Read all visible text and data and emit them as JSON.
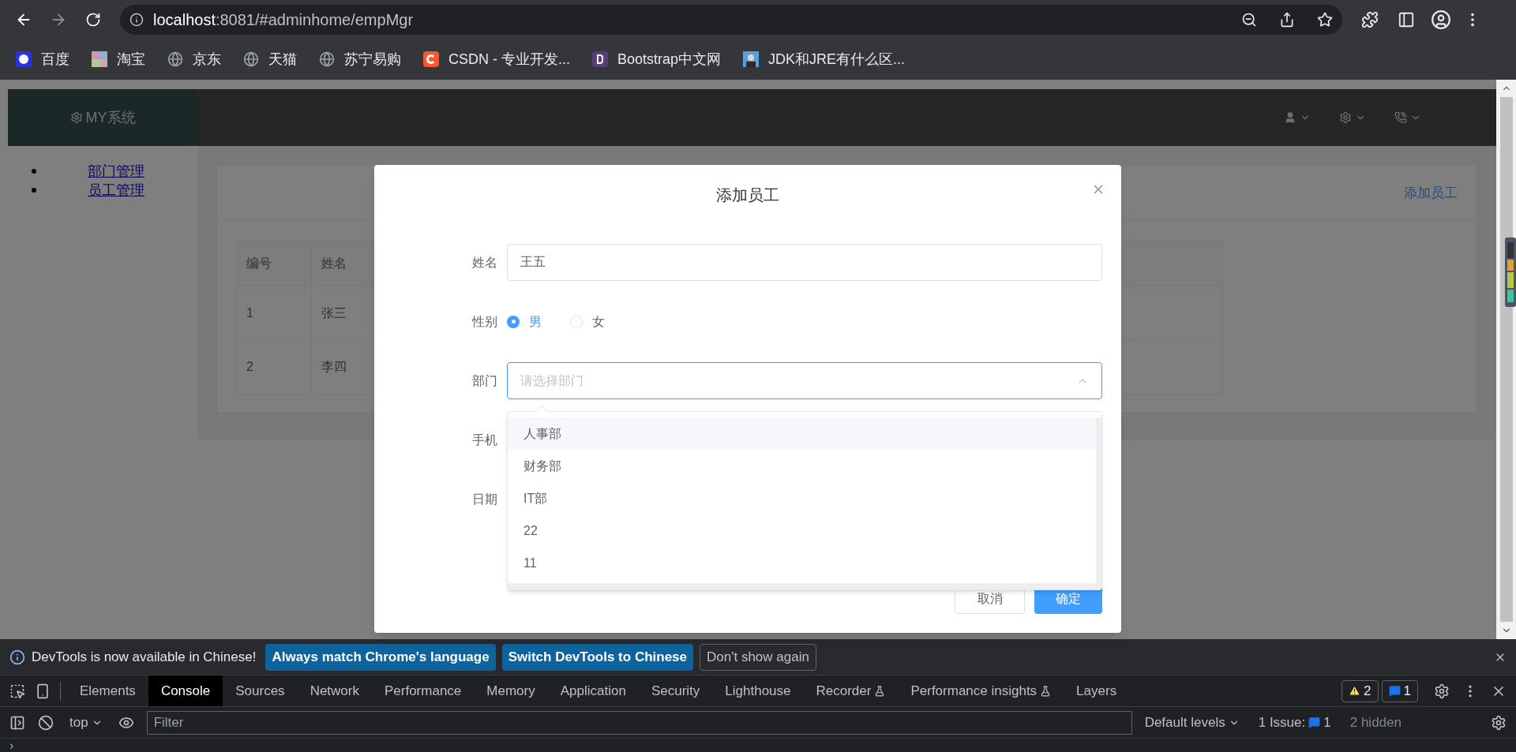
{
  "browser": {
    "back_enabled": true,
    "forward_enabled": false,
    "url_host": "localhost",
    "url_rest": ":8081/#adminhome/empMgr",
    "bookmarks": [
      {
        "label": "百度",
        "kind": "baidu"
      },
      {
        "label": "淘宝",
        "kind": "mosaic"
      },
      {
        "label": "京东",
        "kind": "globe"
      },
      {
        "label": "天猫",
        "kind": "globe"
      },
      {
        "label": "苏宁易购",
        "kind": "globe"
      },
      {
        "label": "CSDN - 专业开发...",
        "kind": "csdn"
      },
      {
        "label": "Bootstrap中文网",
        "kind": "bootstrap"
      },
      {
        "label": "JDK和JRE有什么区...",
        "kind": "avatar"
      }
    ]
  },
  "app": {
    "logo": "MY系统",
    "sidebar": [
      {
        "label": "部门管理"
      },
      {
        "label": "员工管理"
      }
    ],
    "add_link": "添加员工",
    "table": {
      "columns": [
        "编号",
        "姓名"
      ],
      "rows": [
        [
          "1",
          "张三"
        ],
        [
          "2",
          "李四"
        ]
      ]
    }
  },
  "dialog": {
    "title": "添加员工",
    "fields": [
      {
        "label": "姓名",
        "kind": "text",
        "value": "王五"
      },
      {
        "label": "性别",
        "kind": "radio",
        "options": [
          {
            "label": "男",
            "selected": true
          },
          {
            "label": "女",
            "selected": false
          }
        ]
      },
      {
        "label": "部门",
        "kind": "select",
        "placeholder": "请选择部门",
        "expanded": true
      },
      {
        "label": "手机",
        "kind": "covered"
      },
      {
        "label": "日期",
        "kind": "covered"
      }
    ],
    "dropdown": [
      {
        "label": "人事部",
        "highlighted": true
      },
      {
        "label": "财务部",
        "highlighted": false
      },
      {
        "label": "IT部",
        "highlighted": false
      },
      {
        "label": "22",
        "highlighted": false
      },
      {
        "label": "11",
        "highlighted": false
      }
    ],
    "buttons": [
      {
        "label": "取消",
        "kind": "default"
      },
      {
        "label": "确定",
        "kind": "primary"
      }
    ]
  },
  "devtools": {
    "notice": "DevTools is now available in Chinese!",
    "notice_buttons": [
      {
        "label": "Always match Chrome's language",
        "kind": "primary"
      },
      {
        "label": "Switch DevTools to Chinese",
        "kind": "primary"
      },
      {
        "label": "Don't show again",
        "kind": "plain"
      }
    ],
    "tabs": [
      {
        "label": "Elements",
        "selected": false,
        "experimental": false
      },
      {
        "label": "Console",
        "selected": true,
        "experimental": false
      },
      {
        "label": "Sources",
        "selected": false,
        "experimental": false
      },
      {
        "label": "Network",
        "selected": false,
        "experimental": false
      },
      {
        "label": "Performance",
        "selected": false,
        "experimental": false
      },
      {
        "label": "Memory",
        "selected": false,
        "experimental": false
      },
      {
        "label": "Application",
        "selected": false,
        "experimental": false
      },
      {
        "label": "Security",
        "selected": false,
        "experimental": false
      },
      {
        "label": "Lighthouse",
        "selected": false,
        "experimental": false
      },
      {
        "label": "Recorder",
        "selected": false,
        "experimental": true
      },
      {
        "label": "Performance insights",
        "selected": false,
        "experimental": true
      },
      {
        "label": "Layers",
        "selected": false,
        "experimental": false
      }
    ],
    "warnings": "2",
    "messages": "1",
    "context": "top",
    "filter_placeholder": "Filter",
    "levels": "Default levels",
    "issues_label": "1 Issue:",
    "issues_count": "1",
    "hidden": "2 hidden",
    "prompt": "›"
  }
}
